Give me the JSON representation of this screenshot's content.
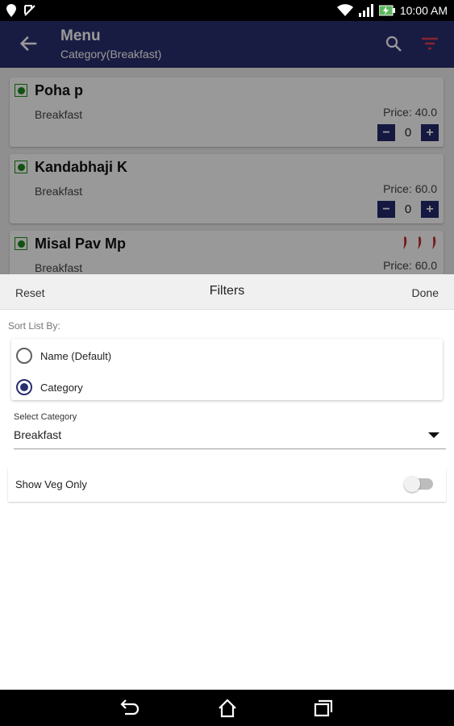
{
  "status_bar": {
    "time": "10:00 AM"
  },
  "app_bar": {
    "title": "Menu",
    "subtitle": "Category(Breakfast)"
  },
  "menu_items": [
    {
      "name": "Poha p",
      "category": "Breakfast",
      "price": "Price: 40.0",
      "quantity": "0"
    },
    {
      "name": "Kandabhaji K",
      "category": "Breakfast",
      "price": "Price: 60.0",
      "quantity": "0"
    },
    {
      "name": "Misal Pav Mp",
      "category": "Breakfast",
      "price": "Price: 60.0"
    }
  ],
  "stepper": {
    "minus": "−",
    "plus": "+"
  },
  "filters": {
    "reset_label": "Reset",
    "title": "Filters",
    "done_label": "Done",
    "sort_label": "Sort List By:",
    "sort_options": [
      {
        "label": "Name (Default)",
        "selected": false
      },
      {
        "label": "Category",
        "selected": true
      }
    ],
    "select_category_label": "Select Category",
    "selected_category": "Breakfast",
    "veg_only_label": "Show Veg Only",
    "veg_only_on": false
  },
  "colors": {
    "primary": "#2a2f6e",
    "veg": "#1b8a1b",
    "spicy": "#c62828"
  },
  "icons": {
    "status_left": [
      "location-pin-icon",
      "notification-icon"
    ],
    "status_right": [
      "wifi-icon",
      "signal-icon",
      "battery-icon"
    ],
    "app_bar": [
      "back-arrow-icon",
      "search-icon",
      "filter-icon"
    ],
    "nav_bar": [
      "back-icon",
      "home-icon",
      "recents-icon"
    ]
  }
}
